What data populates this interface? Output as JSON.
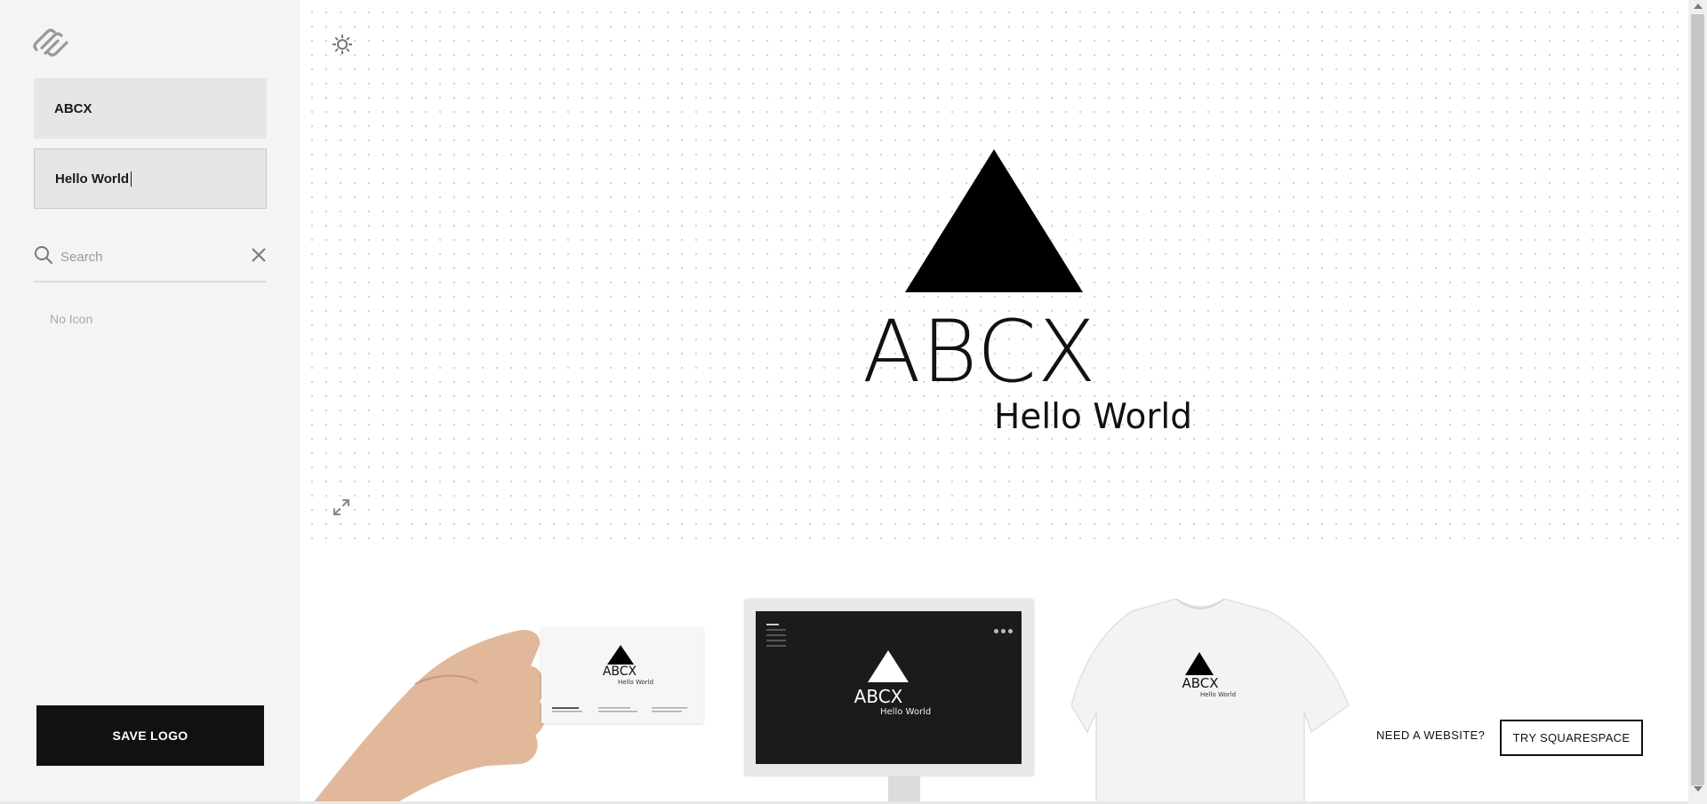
{
  "sidebar": {
    "brand_icon": "squarespace-logo-icon",
    "company_name_value": "ABCX",
    "tagline_value": "Hello World",
    "search": {
      "placeholder": "Search",
      "icon": "search-icon",
      "clear_icon": "close-icon"
    },
    "empty_state": "No Icon",
    "save_label": "SAVE LOGO"
  },
  "canvas": {
    "settings_icon": "gear-icon",
    "expand_icon": "expand-icon",
    "logo": {
      "shape": "triangle",
      "name": "ABCX",
      "tagline": "Hello World"
    }
  },
  "mockups": {
    "card": {
      "name": "ABCX",
      "tagline": "Hello World"
    },
    "monitor": {
      "name": "ABCX",
      "tagline": "Hello World"
    },
    "shirt": {
      "name": "ABCX",
      "tagline": "Hello World"
    }
  },
  "cta": {
    "need_label": "NEED A WEBSITE?",
    "button_label": "TRY SQUARESPACE"
  },
  "colors": {
    "accent": "#111111",
    "sidebar_bg": "#f4f4f4",
    "field_bg": "#e6e6e6"
  }
}
